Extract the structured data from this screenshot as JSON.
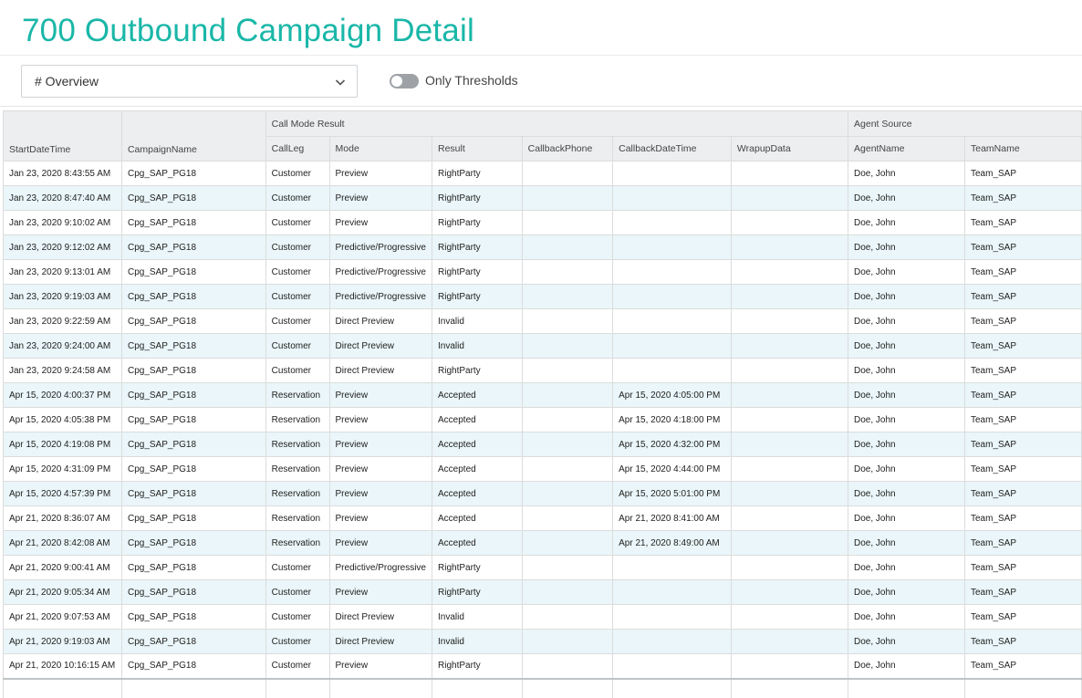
{
  "page": {
    "title": "700 Outbound Campaign Detail"
  },
  "filter": {
    "selected": "# Overview"
  },
  "toggle": {
    "label": "Only Thresholds",
    "on": false
  },
  "colors": {
    "accent": "#1ab7a8",
    "stripe": "#eaf6f9",
    "header_bg": "#eceeef"
  },
  "icons": {
    "dropdown": "chevron-down-icon"
  },
  "table": {
    "groups": {
      "call_mode": "Call Mode Result",
      "agent_source": "Agent Source"
    },
    "columns": [
      "StartDateTime",
      "CampaignName",
      "CallLeg",
      "Mode",
      "Result",
      "CallbackPhone",
      "CallbackDateTime",
      "WrapupData",
      "AgentName",
      "TeamName"
    ],
    "rows": [
      [
        "Jan 23, 2020 8:43:55 AM",
        "Cpg_SAP_PG18",
        "Customer",
        "Preview",
        "RightParty",
        "",
        "",
        "",
        "Doe, John",
        "Team_SAP"
      ],
      [
        "Jan 23, 2020 8:47:40 AM",
        "Cpg_SAP_PG18",
        "Customer",
        "Preview",
        "RightParty",
        "",
        "",
        "",
        "Doe, John",
        "Team_SAP"
      ],
      [
        "Jan 23, 2020 9:10:02 AM",
        "Cpg_SAP_PG18",
        "Customer",
        "Preview",
        "RightParty",
        "",
        "",
        "",
        "Doe, John",
        "Team_SAP"
      ],
      [
        "Jan 23, 2020 9:12:02 AM",
        "Cpg_SAP_PG18",
        "Customer",
        "Predictive/Progressive",
        "RightParty",
        "",
        "",
        "",
        "Doe, John",
        "Team_SAP"
      ],
      [
        "Jan 23, 2020 9:13:01 AM",
        "Cpg_SAP_PG18",
        "Customer",
        "Predictive/Progressive",
        "RightParty",
        "",
        "",
        "",
        "Doe, John",
        "Team_SAP"
      ],
      [
        "Jan 23, 2020 9:19:03 AM",
        "Cpg_SAP_PG18",
        "Customer",
        "Predictive/Progressive",
        "RightParty",
        "",
        "",
        "",
        "Doe, John",
        "Team_SAP"
      ],
      [
        "Jan 23, 2020 9:22:59 AM",
        "Cpg_SAP_PG18",
        "Customer",
        "Direct Preview",
        "Invalid",
        "",
        "",
        "",
        "Doe, John",
        "Team_SAP"
      ],
      [
        "Jan 23, 2020 9:24:00 AM",
        "Cpg_SAP_PG18",
        "Customer",
        "Direct Preview",
        "Invalid",
        "",
        "",
        "",
        "Doe, John",
        "Team_SAP"
      ],
      [
        "Jan 23, 2020 9:24:58 AM",
        "Cpg_SAP_PG18",
        "Customer",
        "Direct Preview",
        "RightParty",
        "",
        "",
        "",
        "Doe, John",
        "Team_SAP"
      ],
      [
        "Apr 15, 2020 4:00:37 PM",
        "Cpg_SAP_PG18",
        "Reservation",
        "Preview",
        "Accepted",
        "",
        "Apr 15, 2020 4:05:00 PM",
        "",
        "Doe, John",
        "Team_SAP"
      ],
      [
        "Apr 15, 2020 4:05:38 PM",
        "Cpg_SAP_PG18",
        "Reservation",
        "Preview",
        "Accepted",
        "",
        "Apr 15, 2020 4:18:00 PM",
        "",
        "Doe, John",
        "Team_SAP"
      ],
      [
        "Apr 15, 2020 4:19:08 PM",
        "Cpg_SAP_PG18",
        "Reservation",
        "Preview",
        "Accepted",
        "",
        "Apr 15, 2020 4:32:00 PM",
        "",
        "Doe, John",
        "Team_SAP"
      ],
      [
        "Apr 15, 2020 4:31:09 PM",
        "Cpg_SAP_PG18",
        "Reservation",
        "Preview",
        "Accepted",
        "",
        "Apr 15, 2020 4:44:00 PM",
        "",
        "Doe, John",
        "Team_SAP"
      ],
      [
        "Apr 15, 2020 4:57:39 PM",
        "Cpg_SAP_PG18",
        "Reservation",
        "Preview",
        "Accepted",
        "",
        "Apr 15, 2020 5:01:00 PM",
        "",
        "Doe, John",
        "Team_SAP"
      ],
      [
        "Apr 21, 2020 8:36:07 AM",
        "Cpg_SAP_PG18",
        "Reservation",
        "Preview",
        "Accepted",
        "",
        "Apr 21, 2020 8:41:00 AM",
        "",
        "Doe, John",
        "Team_SAP"
      ],
      [
        "Apr 21, 2020 8:42:08 AM",
        "Cpg_SAP_PG18",
        "Reservation",
        "Preview",
        "Accepted",
        "",
        "Apr 21, 2020 8:49:00 AM",
        "",
        "Doe, John",
        "Team_SAP"
      ],
      [
        "Apr 21, 2020 9:00:41 AM",
        "Cpg_SAP_PG18",
        "Customer",
        "Predictive/Progressive",
        "RightParty",
        "",
        "",
        "",
        "Doe, John",
        "Team_SAP"
      ],
      [
        "Apr 21, 2020 9:05:34 AM",
        "Cpg_SAP_PG18",
        "Customer",
        "Preview",
        "RightParty",
        "",
        "",
        "",
        "Doe, John",
        "Team_SAP"
      ],
      [
        "Apr 21, 2020 9:07:53 AM",
        "Cpg_SAP_PG18",
        "Customer",
        "Direct Preview",
        "Invalid",
        "",
        "",
        "",
        "Doe, John",
        "Team_SAP"
      ],
      [
        "Apr 21, 2020 9:19:03 AM",
        "Cpg_SAP_PG18",
        "Customer",
        "Direct Preview",
        "Invalid",
        "",
        "",
        "",
        "Doe, John",
        "Team_SAP"
      ],
      [
        "Apr 21, 2020 10:16:15 AM",
        "Cpg_SAP_PG18",
        "Customer",
        "Preview",
        "RightParty",
        "",
        "",
        "",
        "Doe, John",
        "Team_SAP"
      ]
    ]
  }
}
